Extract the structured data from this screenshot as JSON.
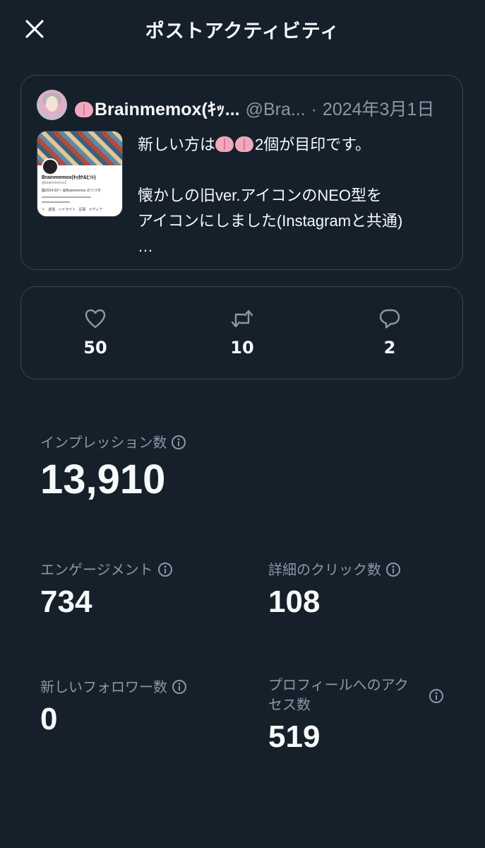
{
  "header": {
    "title": "ポストアクティビティ"
  },
  "post": {
    "author_name": "Brainmemox(ｷｯ...",
    "handle": "@Bra...",
    "separator": "·",
    "date": "2024年3月1日",
    "text_line1_a": "新しい方は",
    "text_line1_b": "2個が目印です。",
    "text_line2": "懐かしの旧ver.アイコンのNEO型を",
    "text_line3": "アイコンにしました(Instagramと共通)",
    "text_more": "…",
    "thumbnail": {
      "name": "Brainmemox(ｷｯｶｹ&ﾋﾝﾄ)",
      "handle": "@brainmemox2",
      "bio": "脳2024.03〜 @Brainmemox のつづき",
      "tabs": [
        "ト",
        "返信",
        "ハイライト",
        "記事",
        "メディア"
      ]
    }
  },
  "engagement": {
    "likes": "50",
    "reposts": "10",
    "replies": "2"
  },
  "metrics": {
    "impressions": {
      "label": "インプレッション数",
      "value": "13,910"
    },
    "engagements": {
      "label": "エンゲージメント",
      "value": "734"
    },
    "detail_clicks": {
      "label": "詳細のクリック数",
      "value": "108"
    },
    "new_followers": {
      "label": "新しいフォロワー数",
      "value": "0"
    },
    "profile_visits": {
      "label_line1": "プロフィールへのアク",
      "label_line2": "セス数",
      "value": "519"
    }
  },
  "colors": {
    "background": "#15202b",
    "border": "#38444d",
    "secondary_text": "#8b98a5",
    "primary_text": "#f7f9f9"
  }
}
